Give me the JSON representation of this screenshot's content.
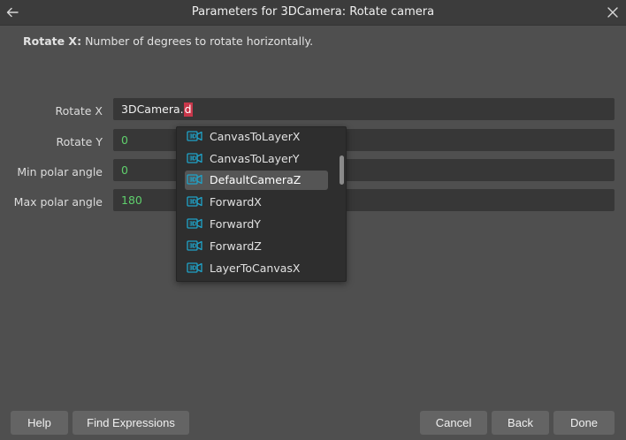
{
  "window": {
    "title": "Parameters for 3DCamera: Rotate camera"
  },
  "description": {
    "param_name": "Rotate X:",
    "text": "Number of degrees to rotate horizontally."
  },
  "params": [
    {
      "label": "Rotate X",
      "value_prefix": "3DCamera.",
      "value_cursor": "d"
    },
    {
      "label": "Rotate Y",
      "value": "0"
    },
    {
      "label": "Min polar angle",
      "value": "0"
    },
    {
      "label": "Max polar angle",
      "value": "180"
    }
  ],
  "autocomplete": {
    "items": [
      "CanvasToLayerX",
      "CanvasToLayerY",
      "DefaultCameraZ",
      "ForwardX",
      "ForwardY",
      "ForwardZ",
      "LayerToCanvasX"
    ],
    "selected": "DefaultCameraZ",
    "icon": "3d-camera-icon"
  },
  "buttons": {
    "help": "Help",
    "find_expressions": "Find Expressions",
    "cancel": "Cancel",
    "back": "Back",
    "done": "Done"
  },
  "colors": {
    "background": "#4f4f4f",
    "field_bg": "#373737",
    "number_value": "#5fcf6c",
    "cursor_highlight": "#c8374a",
    "icon_accent": "#1fa3c9"
  }
}
